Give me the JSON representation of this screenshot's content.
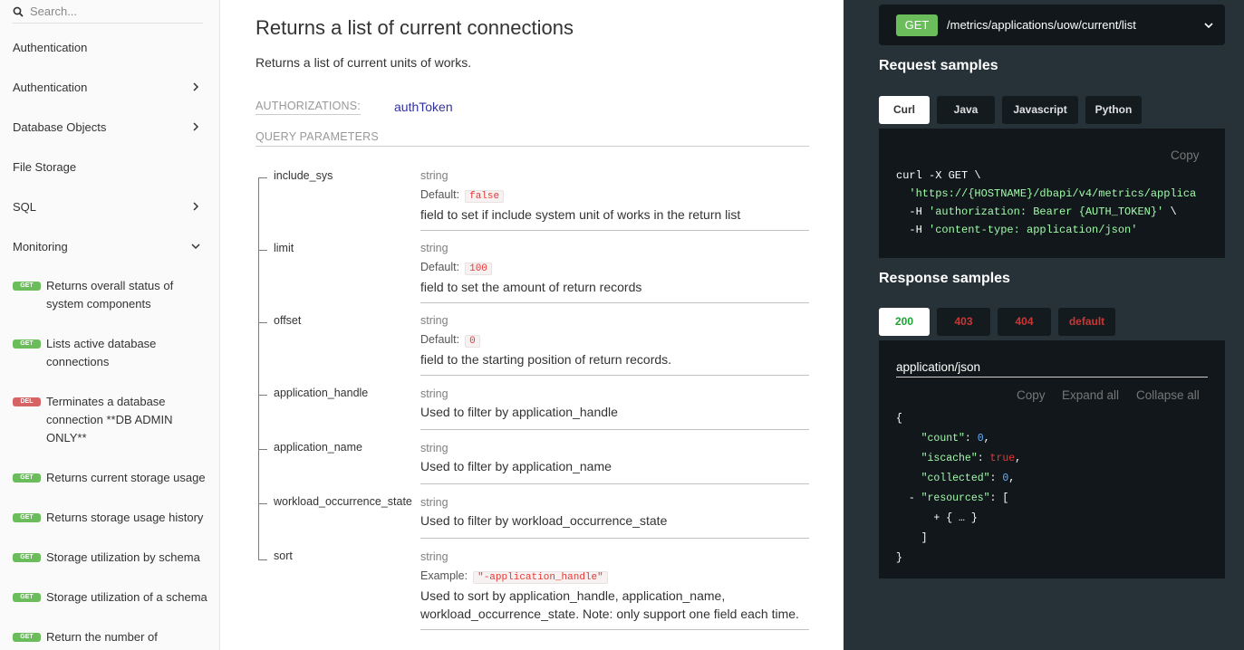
{
  "search": {
    "placeholder": "Search..."
  },
  "sidebar": {
    "items": [
      {
        "label": "Authentication"
      },
      {
        "label": "Authentication"
      },
      {
        "label": "Database Objects"
      },
      {
        "label": "File Storage"
      },
      {
        "label": "SQL"
      },
      {
        "label": "Monitoring"
      }
    ],
    "operations": [
      {
        "method": "GET",
        "label": "Returns overall status of system components"
      },
      {
        "method": "GET",
        "label": "Lists active database connections"
      },
      {
        "method": "DEL",
        "label": "Terminates a database connection **DB ADMIN ONLY**"
      },
      {
        "method": "GET",
        "label": "Returns current storage usage"
      },
      {
        "method": "GET",
        "label": "Returns storage usage history"
      },
      {
        "method": "GET",
        "label": "Storage utilization by schema"
      },
      {
        "method": "GET",
        "label": "Storage utilization of a schema"
      },
      {
        "method": "GET",
        "label": "Return the number of"
      }
    ]
  },
  "main": {
    "title": "Returns a list of current connections",
    "description": "Returns a list of current units of works.",
    "authorizations_label": "AUTHORIZATIONS:",
    "authorizations_value": "authToken",
    "query_params_label": "QUERY PARAMETERS",
    "params": [
      {
        "name": "include_sys",
        "type": "string",
        "default_label": "Default:",
        "default": "false",
        "desc": "field to set if include system unit of works in the return list"
      },
      {
        "name": "limit",
        "type": "string",
        "default_label": "Default:",
        "default": "100",
        "desc": "field to set the amount of return records"
      },
      {
        "name": "offset",
        "type": "string",
        "default_label": "Default:",
        "default": "0",
        "desc": "field to the starting position of return records."
      },
      {
        "name": "application_handle",
        "type": "string",
        "desc": "Used to filter by application_handle"
      },
      {
        "name": "application_name",
        "type": "string",
        "desc": "Used to filter by application_name"
      },
      {
        "name": "workload_occurrence_state",
        "type": "string",
        "desc": "Used to filter by workload_occurrence_state"
      },
      {
        "name": "sort",
        "type": "string",
        "example_label": "Example:",
        "example": "\"-application_handle\"",
        "desc": "Used to sort by application_handle, application_name,",
        "desc2": "workload_occurrence_state. Note: only support one field each time."
      }
    ]
  },
  "right": {
    "method": "GET",
    "path": "/metrics/applications/uow/current/list",
    "request_title": "Request samples",
    "request_tabs": [
      "Curl",
      "Java",
      "Javascript",
      "Python"
    ],
    "copy_label": "Copy",
    "curl": {
      "line1": "curl -X GET \\",
      "line2": "'https://{HOSTNAME}/dbapi/v4/metrics/applica",
      "line3_flag": "-H",
      "line3_str": "'authorization: Bearer {AUTH_TOKEN}'",
      "line3_end": " \\",
      "line4_flag": "-H",
      "line4_str": "'content-type: application/json'"
    },
    "response_title": "Response samples",
    "response_tabs": [
      "200",
      "403",
      "404",
      "default"
    ],
    "content_type": "application/json",
    "expand_all": "Expand all",
    "collapse_all": "Collapse all",
    "json": {
      "open": "{",
      "count_key": "\"count\"",
      "count_val": "0",
      "iscache_key": "\"iscache\"",
      "iscache_val": "true",
      "collected_key": "\"collected\"",
      "collected_val": "0",
      "resources_key": "\"resources\"",
      "collapsed": "+ { … }",
      "close_arr": "]",
      "close": "}"
    },
    "colors": {
      "get": "#6bbd5b",
      "panel": "#263238",
      "code_bg": "#11171a",
      "string": "#a0fbaa",
      "bool": "#e53935",
      "number": "#66b3ff"
    }
  }
}
